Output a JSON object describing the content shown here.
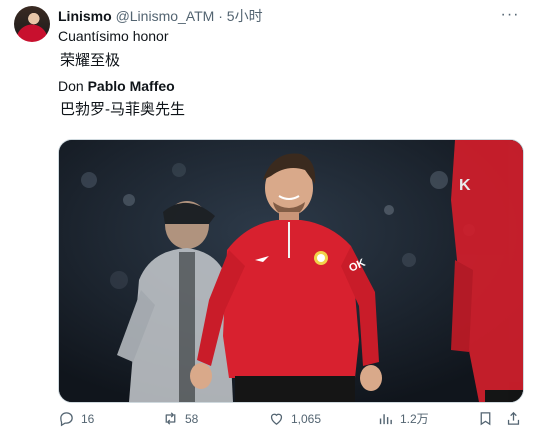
{
  "tweet": {
    "author_name": "Linismo",
    "handle": "@Linismo_ATM",
    "separator": "·",
    "time": "5小时",
    "lines": {
      "line1": "Cuantísimo honor",
      "line2": "荣耀至极",
      "line3_prefix": "Don ",
      "line3_bold": "Pablo Maffeo",
      "line4": "巴勃罗-马菲奥先生"
    },
    "more_glyph": "···"
  },
  "actions": {
    "replies": "16",
    "reposts": "58",
    "likes": "1,065",
    "views": "1.2万"
  },
  "colors": {
    "text": "#0f1419",
    "muted": "#536471",
    "border": "#cfd9de"
  },
  "icons": [
    "reply-icon",
    "repost-icon",
    "like-icon",
    "views-icon",
    "bookmark-icon",
    "share-icon",
    "more-icon"
  ]
}
